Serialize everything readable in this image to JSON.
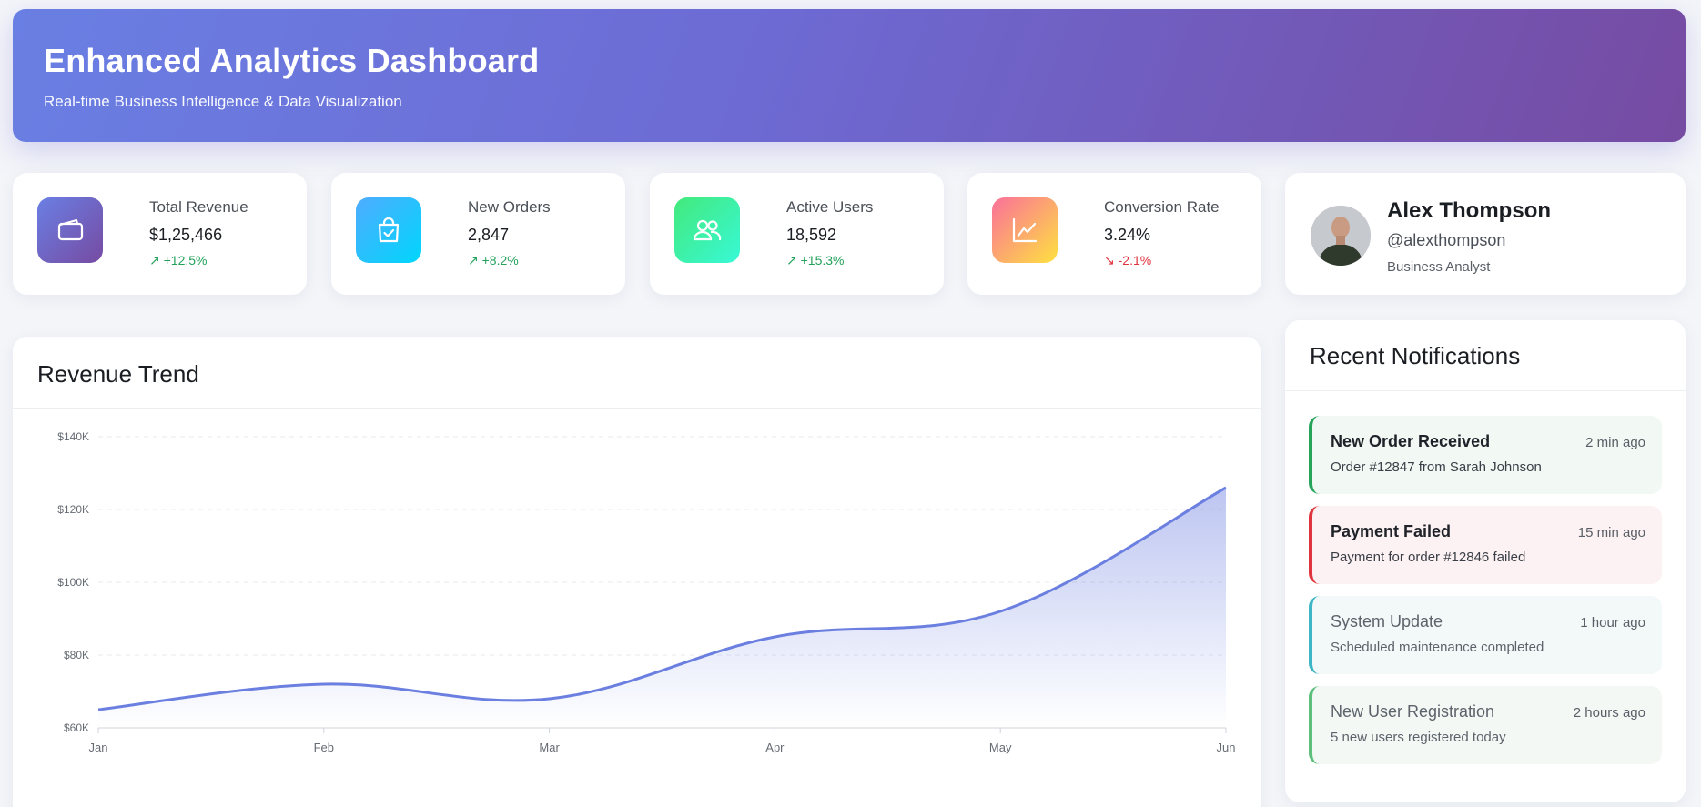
{
  "header": {
    "title": "Enhanced Analytics Dashboard",
    "subtitle": "Real-time Business Intelligence & Data Visualization"
  },
  "stats": [
    {
      "label": "Total Revenue",
      "value": "$1,25,466",
      "change": "↗ +12.5%",
      "trend": "up",
      "icon": "wallet-icon"
    },
    {
      "label": "New Orders",
      "value": "2,847",
      "change": "↗ +8.2%",
      "trend": "up",
      "icon": "shopping-bag-icon"
    },
    {
      "label": "Active Users",
      "value": "18,592",
      "change": "↗ +15.3%",
      "trend": "up",
      "icon": "users-icon"
    },
    {
      "label": "Conversion Rate",
      "value": "3.24%",
      "change": "↘ -2.1%",
      "trend": "down",
      "icon": "line-chart-icon"
    }
  ],
  "profile": {
    "name": "Alex Thompson",
    "handle": "@alexthompson",
    "role": "Business Analyst"
  },
  "revenue": {
    "title": "Revenue Trend"
  },
  "chart_data": {
    "type": "area",
    "title": "Revenue Trend",
    "categories": [
      "Jan",
      "Feb",
      "Mar",
      "Apr",
      "May",
      "Jun"
    ],
    "values": [
      65000,
      72000,
      68000,
      85000,
      92000,
      126000
    ],
    "y_ticks": [
      "$60K",
      "$80K",
      "$100K",
      "$120K",
      "$140K"
    ],
    "ylim": [
      60000,
      140000
    ],
    "grid": true,
    "colors": {
      "line": "#6b7fe0"
    }
  },
  "notifications": {
    "title": "Recent Notifications",
    "items": [
      {
        "title": "New Order Received",
        "time": "2 min ago",
        "message": "Order #12847 from Sarah Johnson",
        "type": "success"
      },
      {
        "title": "Payment Failed",
        "time": "15 min ago",
        "message": "Payment for order #12846 failed",
        "type": "error"
      },
      {
        "title": "System Update",
        "time": "1 hour ago",
        "message": "Scheduled maintenance completed",
        "type": "info"
      },
      {
        "title": "New User Registration",
        "time": "2 hours ago",
        "message": "5 new users registered today",
        "type": "success-muted"
      }
    ]
  },
  "colors": {
    "accent": "#667eea",
    "accent_dark": "#764ba2",
    "success": "#23a15b",
    "danger": "#e0353e",
    "info": "#3fb6c6"
  }
}
